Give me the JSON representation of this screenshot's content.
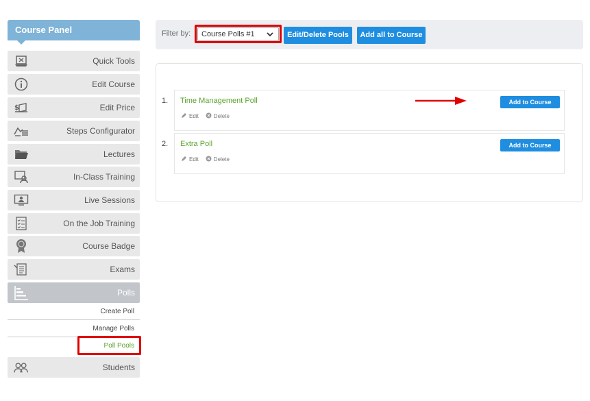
{
  "sidebar": {
    "title": "Course Panel",
    "items": [
      {
        "label": "Quick Tools",
        "icon": "quick-tools-icon"
      },
      {
        "label": "Edit Course",
        "icon": "info-icon"
      },
      {
        "label": "Edit Price",
        "icon": "money-icon"
      },
      {
        "label": "Steps Configurator",
        "icon": "steps-icon"
      },
      {
        "label": "Lectures",
        "icon": "folder-icon"
      },
      {
        "label": "In-Class Training",
        "icon": "classroom-icon"
      },
      {
        "label": "Live Sessions",
        "icon": "monitor-user-icon"
      },
      {
        "label": "On the Job Training",
        "icon": "checklist-icon"
      },
      {
        "label": "Course Badge",
        "icon": "badge-icon"
      },
      {
        "label": "Exams",
        "icon": "exam-icon"
      },
      {
        "label": "Polls",
        "icon": "bar-chart-icon"
      }
    ],
    "subitems": [
      {
        "label": "Create Poll"
      },
      {
        "label": "Manage Polls"
      },
      {
        "label": "Poll Pools"
      }
    ],
    "last_item": {
      "label": "Students",
      "icon": "students-icon"
    }
  },
  "filter": {
    "label": "Filter by:",
    "selected": "Course Polls #1",
    "edit_button": "Edit/Delete Pools",
    "add_all_button": "Add all to Course"
  },
  "polls": [
    {
      "num": "1.",
      "title": "Time Management Poll",
      "edit": "Edit",
      "delete": "Delete",
      "add": "Add to Course"
    },
    {
      "num": "2.",
      "title": "Extra Poll",
      "edit": "Edit",
      "delete": "Delete",
      "add": "Add to Course"
    }
  ],
  "colors": {
    "accent": "#1f8ee0",
    "panel": "#7fb3d8",
    "highlight": "#e00000",
    "green": "#5aa32b"
  }
}
